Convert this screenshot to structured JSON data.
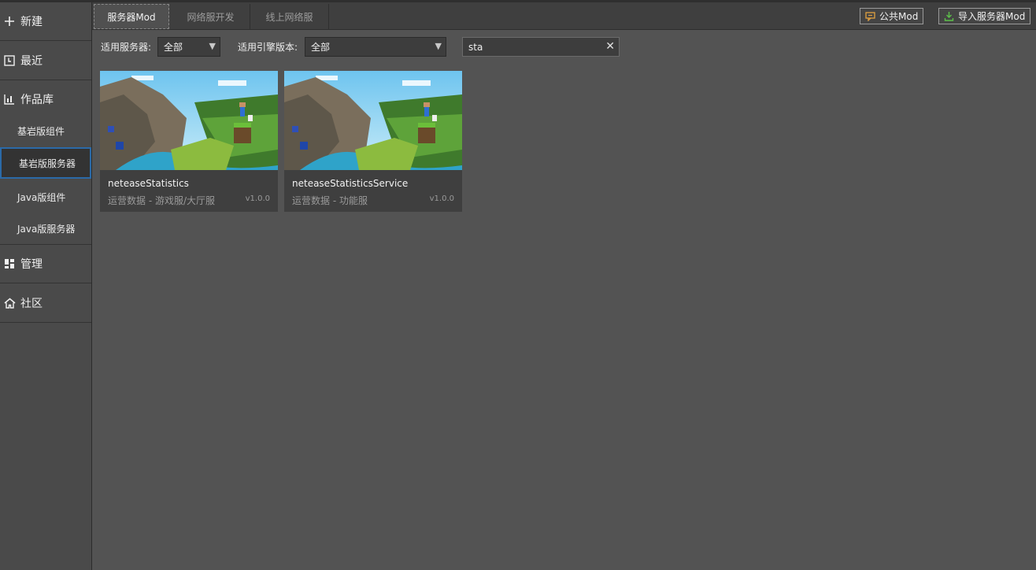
{
  "sidebar": {
    "new_label": "新建",
    "recent_label": "最近",
    "library_label": "作品库",
    "sub_items": [
      "基岩版组件",
      "基岩版服务器",
      "Java版组件",
      "Java版服务器"
    ],
    "manage_label": "管理",
    "community_label": "社区"
  },
  "tabs": [
    "服务器Mod",
    "网络服开发",
    "线上网络服"
  ],
  "toolbar": {
    "public_mod_label": "公共Mod",
    "import_label": "导入服务器Mod"
  },
  "filters": {
    "server_label": "适用服务器:",
    "server_value": "全部",
    "engine_label": "适用引擎版本:",
    "engine_value": "全部",
    "search_value": "sta"
  },
  "cards": [
    {
      "name": "neteaseStatistics",
      "desc": "运营数据 - 游戏服/大厅服",
      "version": "v1.0.0"
    },
    {
      "name": "neteaseStatisticsService",
      "desc": "运营数据 - 功能服",
      "version": "v1.0.0"
    }
  ],
  "colors": {
    "accent_blue": "#2b6aa8",
    "background": "#535353",
    "sidebar": "#4a4a4a"
  }
}
